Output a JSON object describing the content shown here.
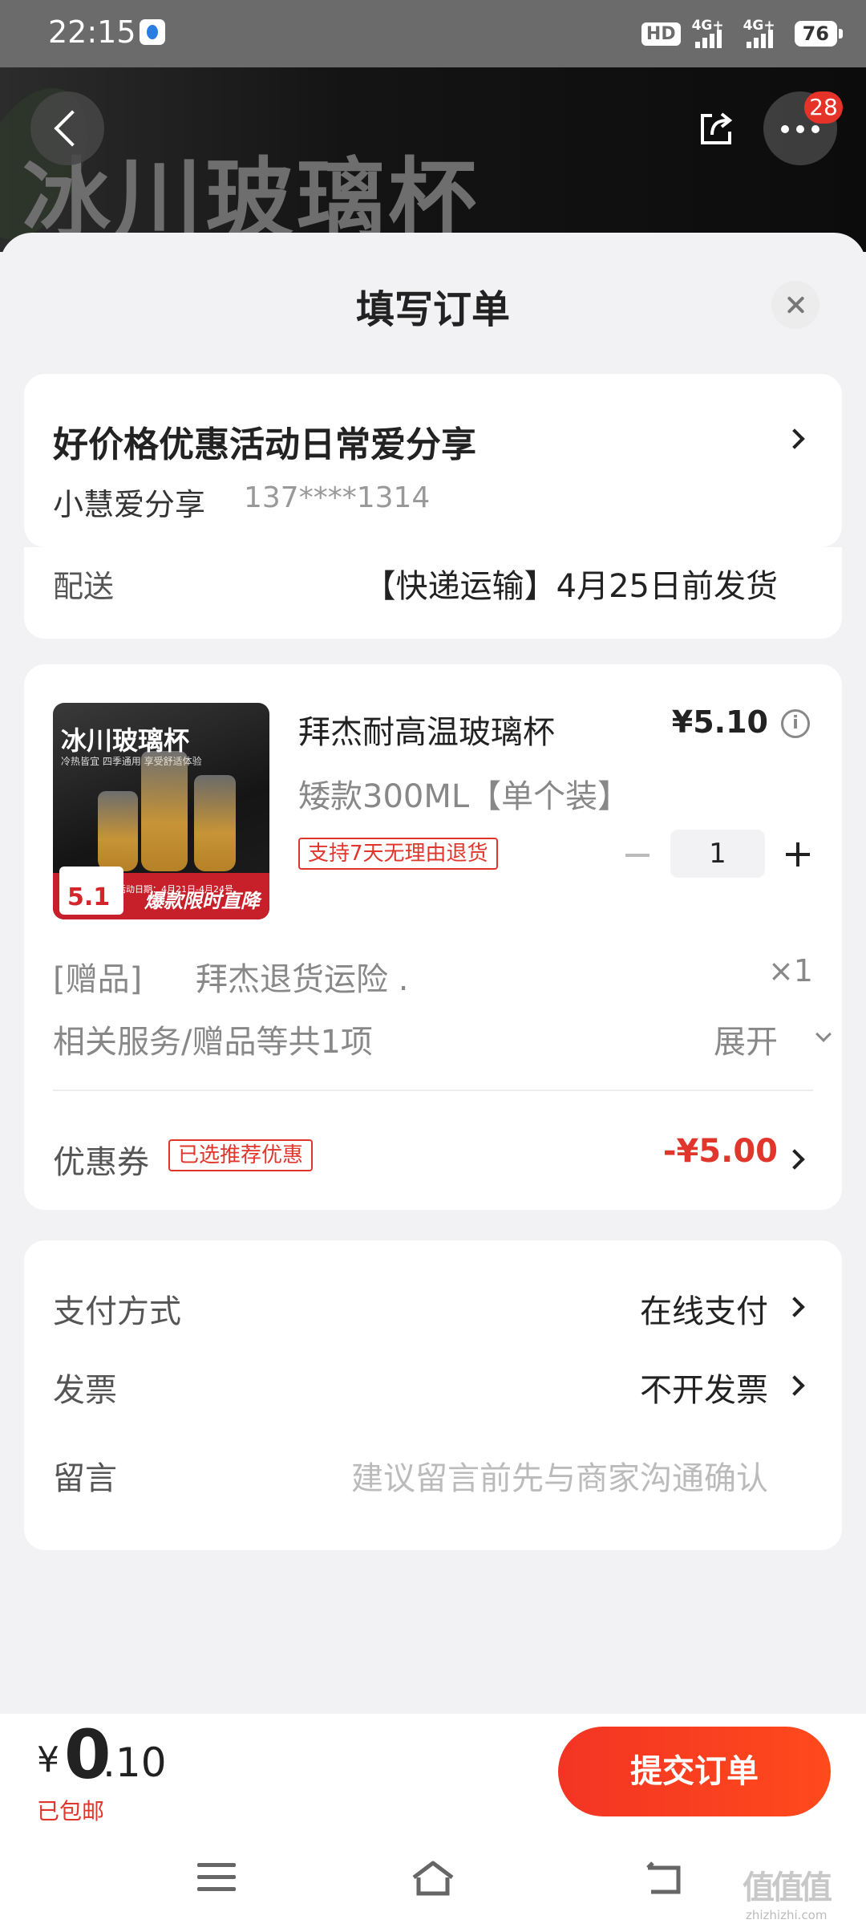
{
  "status_bar": {
    "time": "22:15",
    "hd": "HD",
    "network1": "4G+",
    "network2": "4G+",
    "battery": "76"
  },
  "hero": {
    "product_title_text": "冰川玻璃杯",
    "more_badge": "28"
  },
  "sheet": {
    "title": "填写订单"
  },
  "address": {
    "name": "好价格优惠活动日常爱分享",
    "person": "小慧爱分享",
    "phone": "137****1314",
    "shipping_label": "配送",
    "shipping_value": "【快递运输】4月25日前发货"
  },
  "product": {
    "thumb_title": "冰川玻璃杯",
    "thumb_subtitle": "冷热皆宜 四季通用 享受舒适体验",
    "thumb_price_label": "到手价",
    "thumb_price_value": "5.1",
    "thumb_date": "活动日期：4月21日-4月24号",
    "thumb_slogan": "爆款限时直降",
    "name": "拜杰耐高温玻璃杯",
    "price": "¥5.10",
    "spec": "矮款300ML【单个装】",
    "return_tag": "支持7天无理由退货",
    "quantity": "1",
    "gift_label": "[赠品]",
    "gift_name": "拜杰退货运险 .",
    "gift_qty": "×1",
    "services_text": "相关服务/赠品等共1项",
    "services_expand": "展开",
    "coupon_label": "优惠券",
    "coupon_tag": "已选推荐优惠",
    "coupon_value": "-¥5.00"
  },
  "payment": {
    "method_label": "支付方式",
    "method_value": "在线支付",
    "invoice_label": "发票",
    "invoice_value": "不开发票",
    "message_label": "留言",
    "message_placeholder": "建议留言前先与商家沟通确认"
  },
  "footer": {
    "currency": "¥",
    "total_int": "0",
    "total_dec": ".10",
    "free_shipping": "已包邮",
    "submit": "提交订单"
  },
  "watermark": {
    "text": "值值值",
    "sub": "zhizhizhi.com"
  },
  "colors": {
    "accent": "#e0362c",
    "submit_gradient_start": "#f33424",
    "submit_gradient_end": "#ff4a1c"
  }
}
